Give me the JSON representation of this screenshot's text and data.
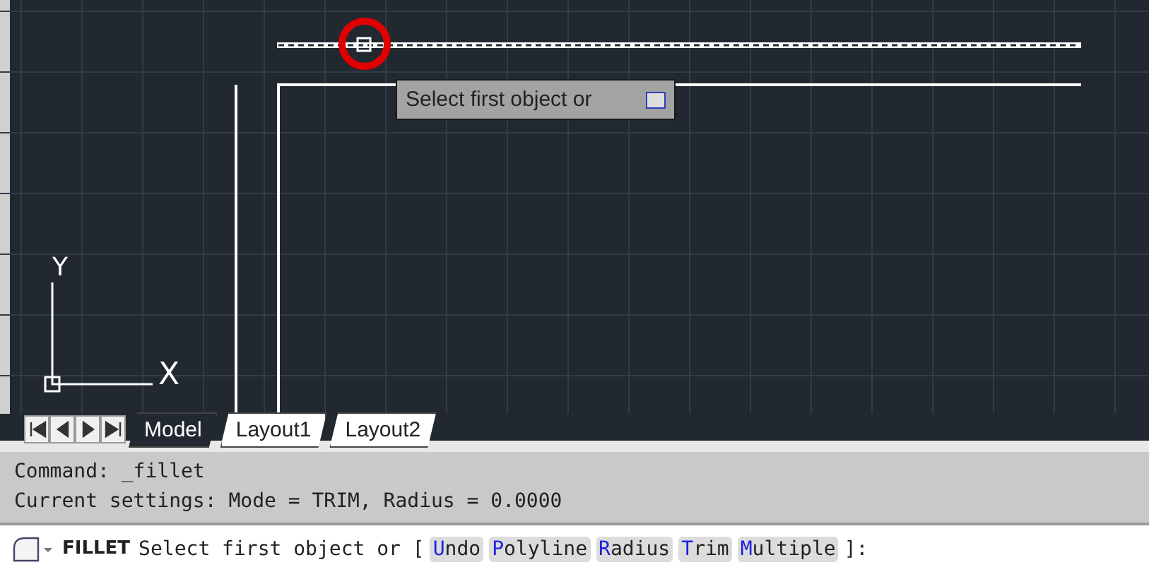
{
  "viewport": {
    "tooltip": {
      "text": "Select first object or"
    },
    "ucs": {
      "y_label": "Y",
      "x_label": "X"
    }
  },
  "layout_tabs": [
    {
      "label": "Model",
      "selected": true
    },
    {
      "label": "Layout1",
      "selected": false
    },
    {
      "label": "Layout2",
      "selected": false
    }
  ],
  "command_history": [
    "Command: _fillet",
    "Current settings: Mode = TRIM, Radius = 0.0000"
  ],
  "command_line": {
    "command": "FILLET",
    "prompt": "Select first object or [",
    "options": [
      {
        "key": "U",
        "rest": "ndo"
      },
      {
        "key": "P",
        "rest": "olyline"
      },
      {
        "key": "R",
        "rest": "adius"
      },
      {
        "key": "T",
        "rest": "rim"
      },
      {
        "key": "M",
        "rest": "ultiple"
      }
    ],
    "suffix": "]:"
  }
}
